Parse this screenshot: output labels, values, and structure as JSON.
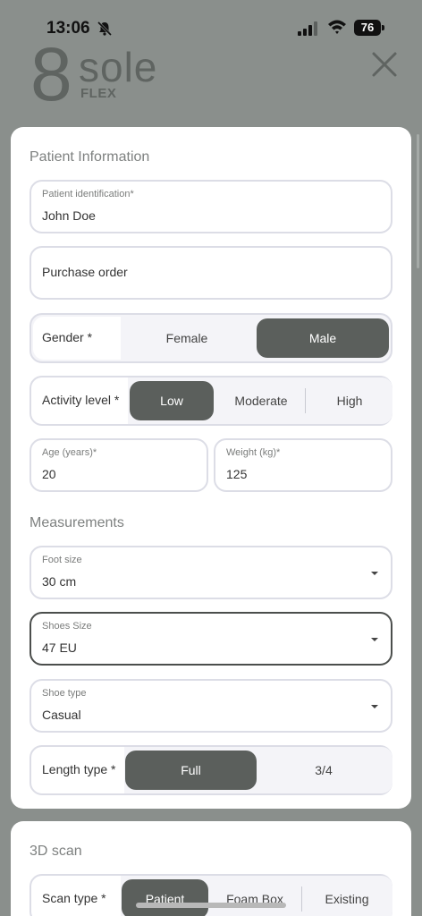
{
  "status_bar": {
    "time": "13:06",
    "battery": "76"
  },
  "logo": {
    "number": "8",
    "word": "sole",
    "sub": "FLEX"
  },
  "patient": {
    "title": "Patient Information",
    "identification": {
      "label": "Patient identification*",
      "value": "John Doe"
    },
    "purchase_order": {
      "placeholder": "Purchase order"
    },
    "gender": {
      "label": "Gender *",
      "options": [
        "Female",
        "Male"
      ],
      "selected": "Male"
    },
    "activity": {
      "label": "Activity level *",
      "options": [
        "Low",
        "Moderate",
        "High"
      ],
      "selected": "Low"
    },
    "age": {
      "label": "Age (years)*",
      "value": "20"
    },
    "weight": {
      "label": "Weight (kg)*",
      "value": "125"
    }
  },
  "measurements": {
    "title": "Measurements",
    "foot_size": {
      "label": "Foot size",
      "value": "30 cm"
    },
    "shoes_size": {
      "label": "Shoes Size",
      "value": "47 EU"
    },
    "shoe_type": {
      "label": "Shoe type",
      "value": "Casual"
    },
    "length_type": {
      "label": "Length type *",
      "options": [
        "Full",
        "3/4"
      ],
      "selected": "Full"
    }
  },
  "scan": {
    "title": "3D scan",
    "scan_type": {
      "label": "Scan type *",
      "options": [
        "Patient",
        "Foam Box",
        "Existing"
      ],
      "selected": "Patient"
    }
  },
  "colors": {
    "accent": "#5b5f5c",
    "background": "#8a8f8c",
    "border": "#dcdde6"
  }
}
